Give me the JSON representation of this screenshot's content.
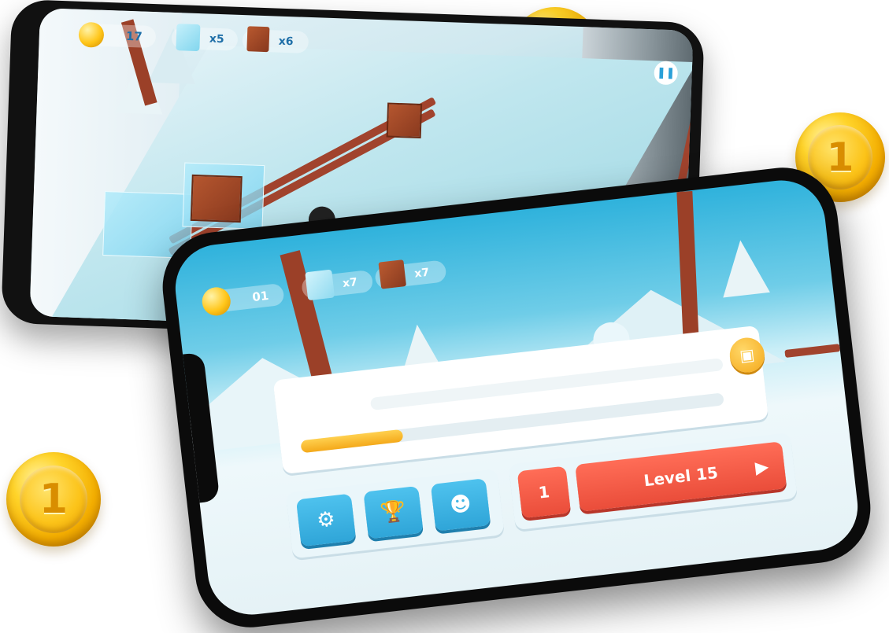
{
  "colors": {
    "accent_blue": "#2fa5d8",
    "accent_red": "#ea4d3a",
    "accent_gold": "#f5a819",
    "hud_text": "#1f6fa8"
  },
  "back_phone": {
    "hud": {
      "coin_count": "17",
      "ice_count": "x5",
      "crate_count": "x6"
    },
    "pause_icon": "pause-icon"
  },
  "front_phone": {
    "hud": {
      "coin_count": "01",
      "ice_count": "x7",
      "crate_count": "x7"
    },
    "progress": {
      "fraction": 0.24
    },
    "icons": {
      "gift": "gift-box-icon",
      "settings": "gear-icon",
      "trophy": "trophy-icon",
      "character": "character-face-icon",
      "play": "play-icon"
    },
    "level_number": "1",
    "play_button_label": "Level 15"
  },
  "decor": {
    "coin_glyph": "1"
  }
}
